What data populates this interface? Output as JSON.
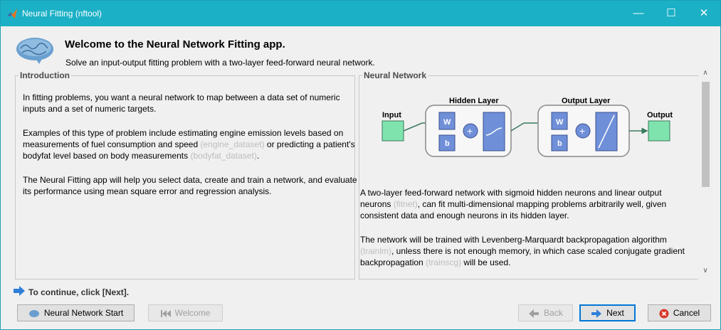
{
  "window": {
    "title": "Neural Fitting (nftool)",
    "minimize": "—",
    "maximize": "☐",
    "close": "✕"
  },
  "header": {
    "title": "Welcome to the Neural Network Fitting app.",
    "subtitle": "Solve an input-output fitting problem with a two-layer feed-forward neural network."
  },
  "intro": {
    "heading": "Introduction",
    "p1": "In fitting problems, you want a neural network to map between a data set of numeric inputs and a set of numeric targets.",
    "p2_a": "Examples of this type of problem include estimating engine emission levels based on measurements of fuel consumption and speed ",
    "p2_link1": "(engine_dataset)",
    "p2_b": " or predicting a patient's bodyfat level based on body measurements ",
    "p2_link2": "(bodyfat_dataset)",
    "p2_c": ".",
    "p3": "The Neural Fitting app will help you select data, create and train a network, and evaluate its performance using mean square error and regression analysis."
  },
  "network": {
    "heading": "Neural Network",
    "diagram": {
      "input_label": "Input",
      "hidden_label": "Hidden Layer",
      "output_layer_label": "Output Layer",
      "output_label": "Output",
      "w": "W",
      "b": "b",
      "plus": "+"
    },
    "p1_a": "A two-layer feed-forward network with sigmoid hidden neurons and linear output neurons ",
    "p1_link": "(fitnet)",
    "p1_b": ", can fit multi-dimensional mapping problems arbitrarily well, given consistent data and enough neurons in its hidden layer.",
    "p2_a": "The network will be trained with Levenberg-Marquardt backpropagation algorithm ",
    "p2_link1": "(trainlm)",
    "p2_b": ", unless there is not enough memory, in which case scaled conjugate gradient backpropagation ",
    "p2_link2": "(trainscg)",
    "p2_c": " will be used."
  },
  "footer": {
    "continue": "To continue, click [Next].",
    "nn_start": "Neural Network Start",
    "welcome": "Welcome",
    "back": "Back",
    "next": "Next",
    "cancel": "Cancel"
  },
  "colors": {
    "titlebar": "#1bb0c6",
    "accent": "#0078d7",
    "diagram_green": "#77e0a8",
    "diagram_blue": "#6f8fd8"
  }
}
